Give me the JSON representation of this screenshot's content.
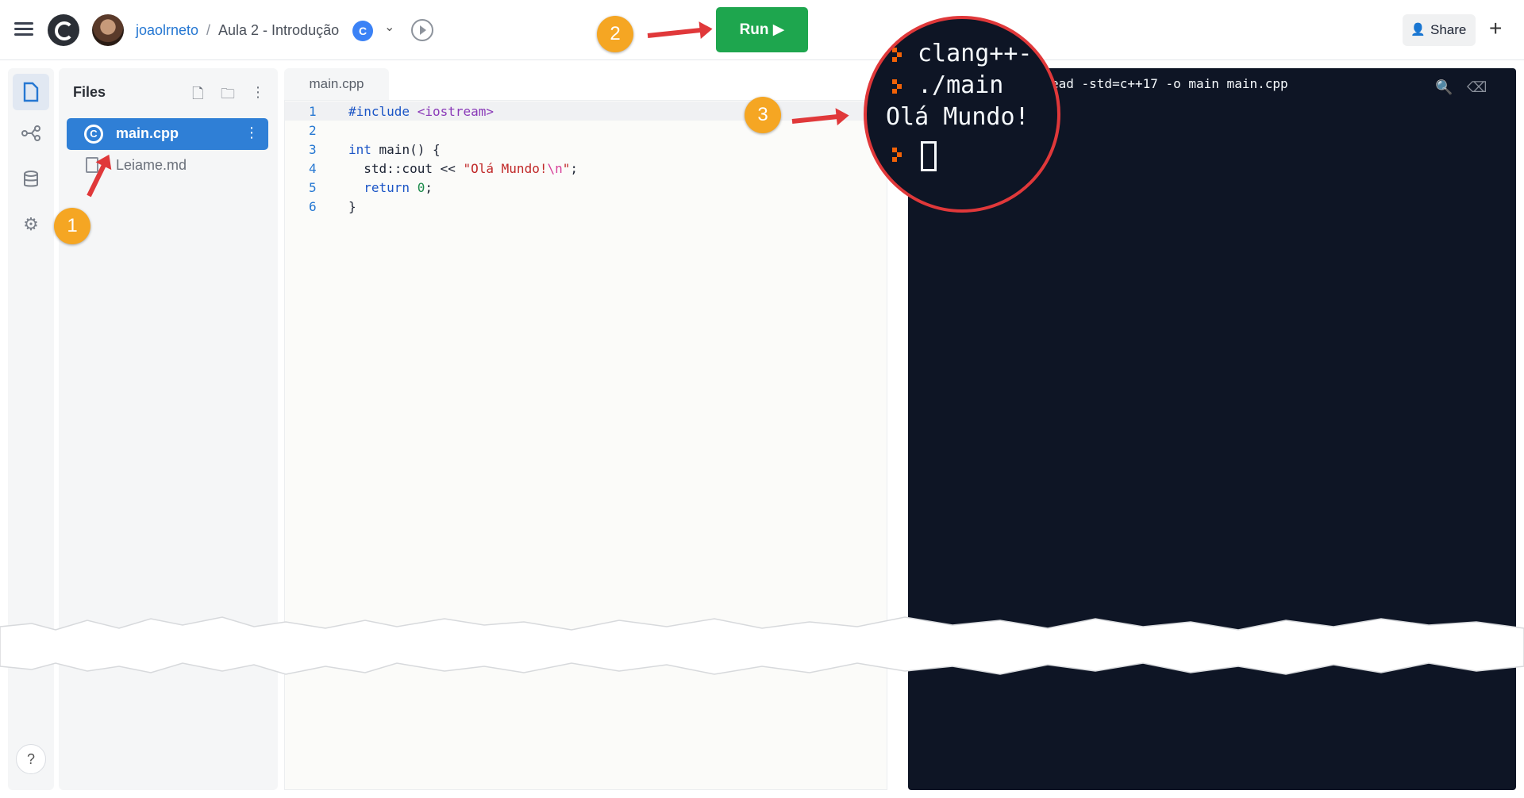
{
  "topbar": {
    "user": "joaolrneto",
    "separator": "/",
    "repl_title": "Aula 2 - Introdução",
    "lang_badge": "C",
    "run_label": "Run ▶",
    "share_label": "Share",
    "add_label": "+"
  },
  "sidebar": {
    "files_title": "Files",
    "files": [
      {
        "name": "main.cpp",
        "active": true
      },
      {
        "name": "Leiame.md",
        "active": false
      }
    ],
    "help_label": "?"
  },
  "editor": {
    "tab_label": "main.cpp",
    "line_numbers": [
      "1",
      "2",
      "3",
      "4",
      "5",
      "6"
    ],
    "lines": [
      "#include <iostream>",
      "",
      "int main() {",
      "  std::cout << \"Olá Mundo!\\n\";",
      "  return 0;",
      "}"
    ]
  },
  "console": {
    "command_fragment": "ead -std=c++17 -o main main.cpp",
    "zoom_lines": [
      "clang++-",
      "./main",
      "Olá Mundo!"
    ]
  },
  "annotations": {
    "step1": "1",
    "step2": "2",
    "step3": "3"
  },
  "colors": {
    "run_button": "#1ea64e",
    "active_file": "#2f7fd6",
    "console_bg": "#0e1525",
    "badge": "#f5a623",
    "arrow": "#e0383a"
  }
}
